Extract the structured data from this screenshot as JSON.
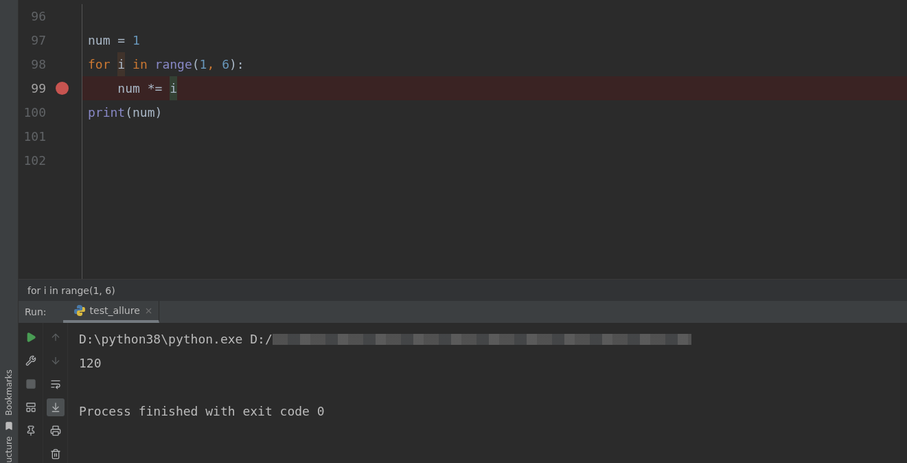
{
  "editor": {
    "lines": [
      {
        "number": "96",
        "breakpoint": false,
        "current": false
      },
      {
        "number": "97",
        "breakpoint": false,
        "current": false,
        "tokens": [
          {
            "text": "num = ",
            "kind": "plain"
          },
          {
            "text": "1",
            "kind": "number"
          }
        ]
      },
      {
        "number": "98",
        "breakpoint": false,
        "current": false,
        "tokens": [
          {
            "text": "for ",
            "kind": "keyword"
          },
          {
            "text": "i",
            "kind": "read-highlight"
          },
          {
            "text": " in ",
            "kind": "keyword"
          },
          {
            "text": "range",
            "kind": "builtin"
          },
          {
            "text": "(",
            "kind": "plain"
          },
          {
            "text": "1",
            "kind": "number"
          },
          {
            "text": ", ",
            "kind": "keyword"
          },
          {
            "text": "6",
            "kind": "number"
          },
          {
            "text": "):",
            "kind": "plain"
          }
        ]
      },
      {
        "number": "99",
        "breakpoint": true,
        "current": true,
        "tokens": [
          {
            "text": "    num *= ",
            "kind": "plain"
          },
          {
            "text": "i",
            "kind": "write-highlight"
          }
        ]
      },
      {
        "number": "100",
        "breakpoint": false,
        "current": false,
        "tokens": [
          {
            "text": "print",
            "kind": "builtin"
          },
          {
            "text": "(num)",
            "kind": "plain"
          }
        ]
      },
      {
        "number": "101",
        "breakpoint": false,
        "current": false
      },
      {
        "number": "102",
        "breakpoint": false,
        "current": false
      }
    ]
  },
  "breadcrumb": "for i in range(1, 6)",
  "side_stripe": [
    "Bookmarks",
    "ucture"
  ],
  "run_panel": {
    "label": "Run:",
    "tabs": [
      {
        "title": "test_allure",
        "selected": true
      }
    ],
    "toolbar_1": [
      {
        "kind": "play",
        "disabled": false
      },
      {
        "kind": "wrench",
        "disabled": false
      },
      {
        "kind": "stop",
        "disabled": true
      },
      {
        "kind": "layout",
        "disabled": false
      },
      {
        "kind": "pin",
        "disabled": false
      }
    ],
    "toolbar_2": [
      {
        "kind": "up",
        "disabled": true,
        "selected": false
      },
      {
        "kind": "down",
        "disabled": true,
        "selected": false
      },
      {
        "kind": "wrap",
        "disabled": false,
        "selected": false
      },
      {
        "kind": "scroll-end",
        "disabled": false,
        "selected": true
      },
      {
        "kind": "print",
        "disabled": false,
        "selected": false
      },
      {
        "kind": "trash",
        "disabled": false,
        "selected": false
      }
    ],
    "console": [
      {
        "text": "D:\\python38\\python.exe D:/",
        "redacted": true,
        "blank_before": false
      },
      {
        "text": "120",
        "redacted": false,
        "blank_before": false
      },
      {
        "text": "Process finished with exit code 0",
        "redacted": false,
        "blank_before": true
      }
    ]
  }
}
